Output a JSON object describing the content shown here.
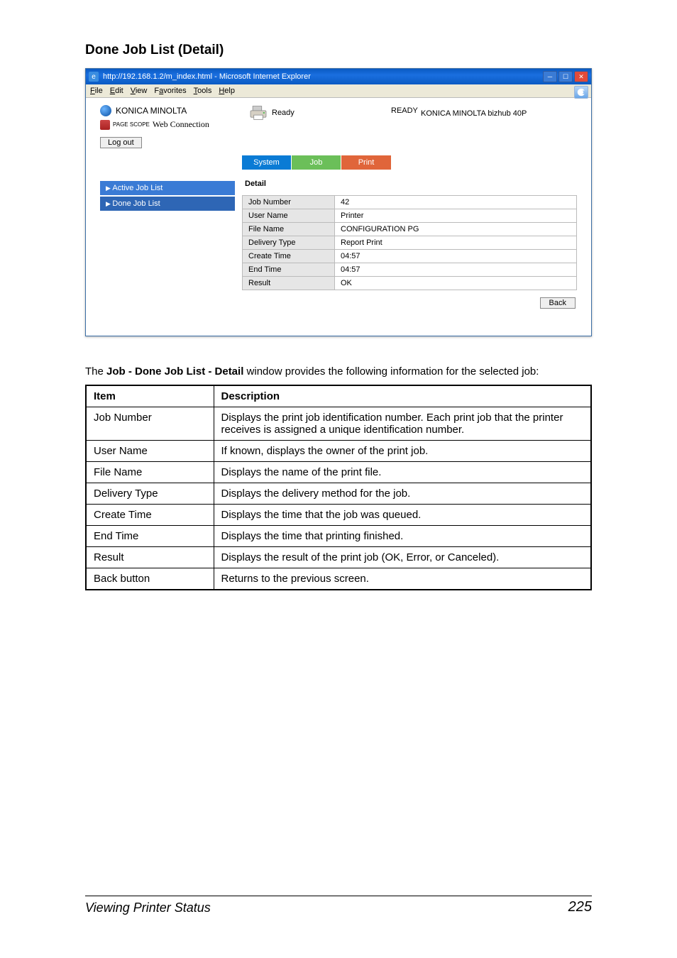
{
  "page_heading": "Done Job List (Detail)",
  "browser": {
    "title": "http://192.168.1.2/m_index.html - Microsoft Internet Explorer",
    "menu": [
      "File",
      "Edit",
      "View",
      "Favorites",
      "Tools",
      "Help"
    ],
    "brand": {
      "company": "KONICA MINOLTA",
      "product_prefix": "PAGE SCOPE",
      "product_name": "Web Connection"
    },
    "status": {
      "label": "Ready",
      "main": "READY"
    },
    "model": "KONICA MINOLTA bizhub 40P",
    "logout_label": "Log out",
    "tabs": {
      "system": "System",
      "job": "Job",
      "print": "Print"
    },
    "sidebar": {
      "active": "Active Job List",
      "done": "Done Job List"
    },
    "detail": {
      "title": "Detail",
      "rows": [
        {
          "key": "Job Number",
          "val": "42"
        },
        {
          "key": "User Name",
          "val": "Printer"
        },
        {
          "key": "File Name",
          "val": "CONFIGURATION PG"
        },
        {
          "key": "Delivery Type",
          "val": "Report Print"
        },
        {
          "key": "Create Time",
          "val": "04:57"
        },
        {
          "key": "End Time",
          "val": "04:57"
        },
        {
          "key": "Result",
          "val": "OK"
        }
      ],
      "back_label": "Back"
    }
  },
  "caption": {
    "line": "The Job - Done Job List - Detail window provides the following information for the selected job:",
    "bold_part": "Job - Done Job List - Detail"
  },
  "info_table": {
    "headers": [
      "Item",
      "Description"
    ],
    "rows": [
      {
        "item": "Job Number",
        "desc": "Displays the print job identification number. Each print job that the printer receives is assigned a unique identification number."
      },
      {
        "item": "User Name",
        "desc": "If known, displays the owner of the print job."
      },
      {
        "item": "File Name",
        "desc": "Displays the name of the print file."
      },
      {
        "item": "Delivery Type",
        "desc": "Displays the delivery method for the job."
      },
      {
        "item": "Create Time",
        "desc": "Displays the time that the job was queued."
      },
      {
        "item": "End Time",
        "desc": "Displays the time that printing finished."
      },
      {
        "item": "Result",
        "desc": "Displays the result of the print job (OK, Error, or Canceled)."
      },
      {
        "item": "Back button",
        "desc": "Returns to the previous screen."
      }
    ]
  },
  "footer": {
    "title": "Viewing Printer Status",
    "page": "225"
  }
}
